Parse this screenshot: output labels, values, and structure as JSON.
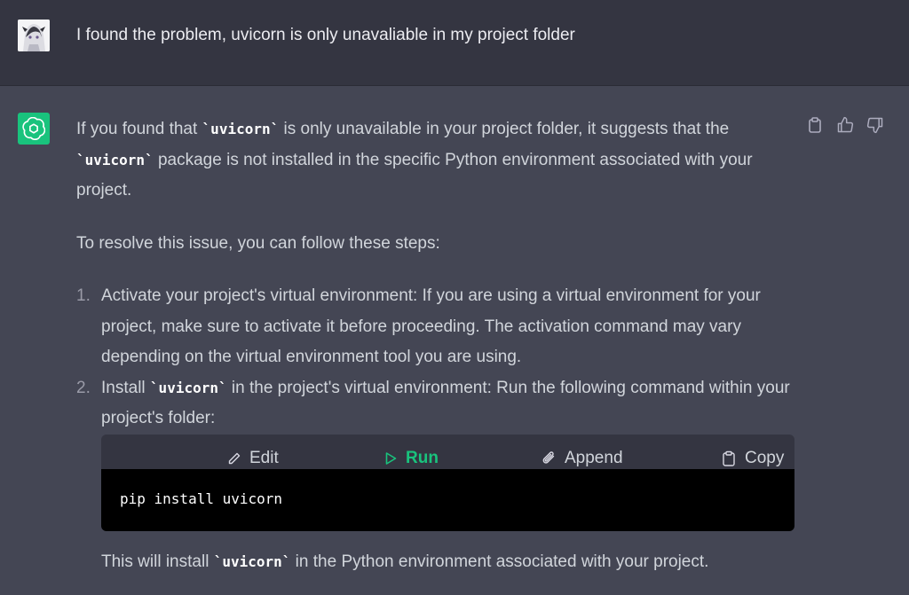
{
  "user": {
    "message": "I found the problem, uvicorn is only unavaliable in my project folder"
  },
  "assistant": {
    "intro_parts": [
      "If you found that ",
      "`uvicorn`",
      " is only unavailable in your project folder, it suggests that the ",
      "`uvicorn`",
      " package is not installed in the specific Python environment associated with your project."
    ],
    "resolve_text": "To resolve this issue, you can follow these steps:",
    "steps": [
      {
        "number": "1.",
        "text": "Activate your project's virtual environment: If you are using a virtual environment for your project, make sure to activate it before proceeding. The activation command may vary depending on the virtual environment tool you are using."
      },
      {
        "number": "2.",
        "pre": "Install ",
        "code": "`uvicorn`",
        "post": " in the project's virtual environment: Run the following command within your project's folder:"
      }
    ],
    "codeblock": {
      "edit_label": "Edit",
      "run_label": "Run",
      "append_label": "Append",
      "copy_label": "Copy",
      "code": "pip install uvicorn"
    },
    "after": {
      "pre": "This will install ",
      "code": "`uvicorn`",
      "post": " in the Python environment associated with your project."
    }
  },
  "colors": {
    "accent": "#19c37d",
    "user_bg": "#343541",
    "assistant_bg": "#444654"
  }
}
